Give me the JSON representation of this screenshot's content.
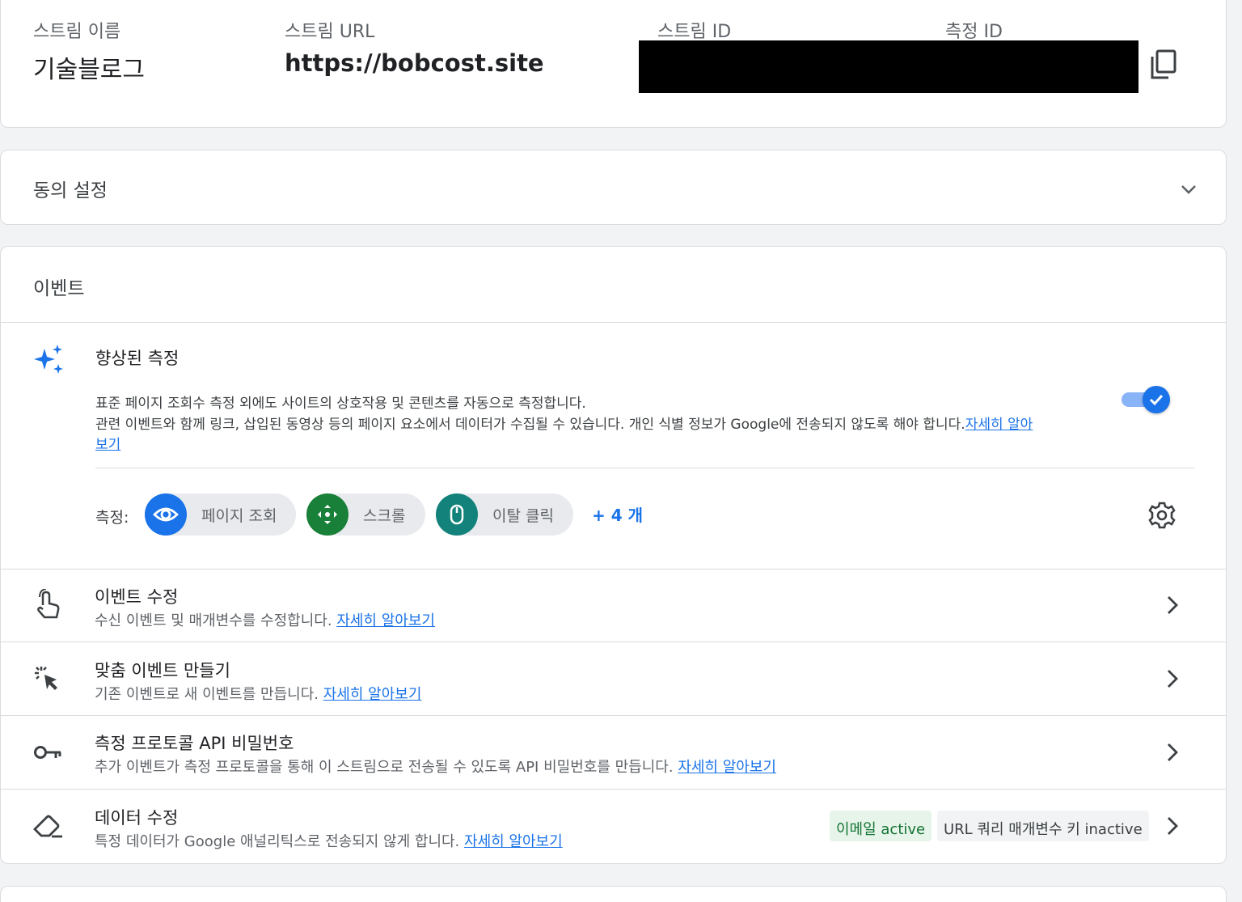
{
  "stream": {
    "name_label": "스트림 이름",
    "name_value": "기술블로그",
    "url_label": "스트림 URL",
    "url_value": "https://bobcost.site",
    "id_label": "스트림 ID",
    "measurement_id_label": "측정 ID"
  },
  "consent": {
    "title": "동의 설정"
  },
  "events": {
    "title": "이벤트",
    "enhanced": {
      "title": "향상된 측정",
      "desc1": "표준 페이지 조회수 측정 외에도 사이트의 상호작용 및 콘텐츠를 자동으로 측정합니다.",
      "desc2": "관련 이벤트와 함께 링크, 삽입된 동영상 등의 페이지 요소에서 데이터가 수집될 수 있습니다. 개인 식별 정보가 Google에 전송되지 않도록 해야 합니다.",
      "learn_more_a": "자세히 알아",
      "learn_more_b": "보기",
      "toggle_on": true,
      "measure_label": "측정:",
      "chips": [
        {
          "label": "페이지 조회",
          "color": "#1a73e8",
          "icon": "eye-icon"
        },
        {
          "label": "스크롤",
          "color": "#188038",
          "icon": "scroll-arrows-icon"
        },
        {
          "label": "이탈 클릭",
          "color": "#12827a",
          "icon": "mouse-icon"
        }
      ],
      "more": "+ 4 개"
    },
    "rows": [
      {
        "title": "이벤트 수정",
        "sub": "수신 이벤트 및 매개변수를 수정합니다.",
        "link": "자세히 알아보기",
        "icon": "touch-hand-icon"
      },
      {
        "title": "맞춤 이벤트 만들기",
        "sub": "기존 이벤트로 새 이벤트를 만듭니다.",
        "link": "자세히 알아보기",
        "icon": "cursor-click-icon"
      },
      {
        "title": "측정 프로토콜 API 비밀번호",
        "sub": "추가 이벤트가 측정 프로토콜을 통해 이 스트림으로 전송될 수 있도록 API 비밀번호를 만듭니다.",
        "link": "자세히 알아보기",
        "icon": "key-icon"
      },
      {
        "title": "데이터 수정",
        "sub": "특정 데이터가 Google 애널리틱스로 전송되지 않게 합니다.",
        "link": "자세히 알아보기",
        "icon": "eraser-icon"
      }
    ],
    "tags": [
      {
        "label": "이메일 active",
        "status": "active"
      },
      {
        "label": "URL 쿼리 매개변수 키 inactive",
        "status": "inactive"
      }
    ]
  }
}
